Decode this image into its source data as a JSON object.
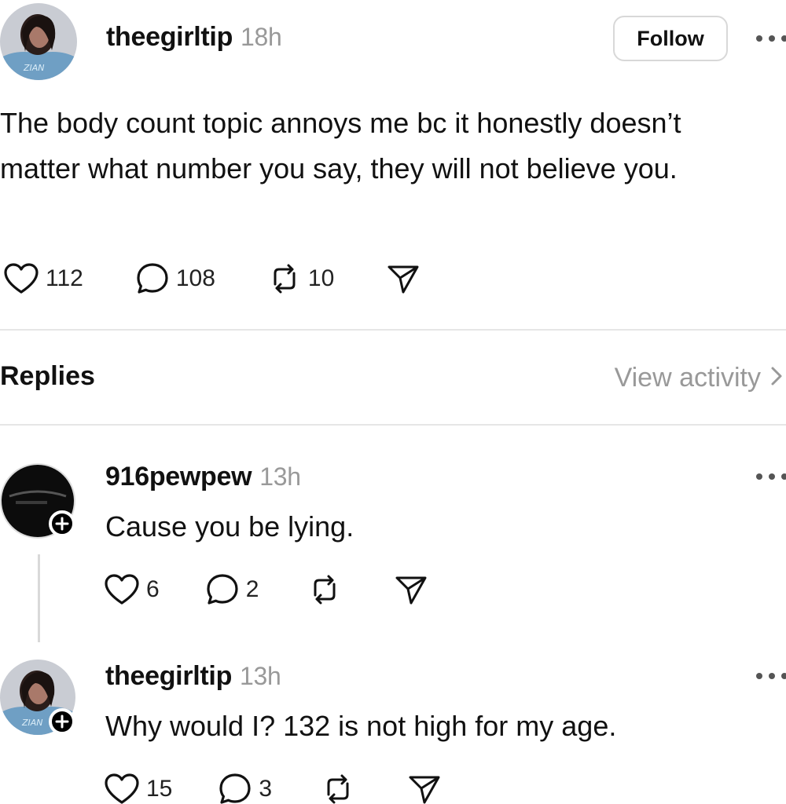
{
  "post": {
    "username": "theegirltip",
    "time": "18h",
    "follow_label": "Follow",
    "text": "The body count topic annoys me bc it honestly doesn’t matter what number you say, they will not believe you.",
    "likes": "112",
    "comments": "108",
    "reposts": "10"
  },
  "replies_section": {
    "title": "Replies",
    "view_activity": "View activity"
  },
  "replies": [
    {
      "username": "916pewpew",
      "time": "13h",
      "text": "Cause you be lying.",
      "likes": "6",
      "comments": "2"
    },
    {
      "username": "theegirltip",
      "time": "13h",
      "text": "Why would I? 132 is not high for my age.",
      "likes": "15",
      "comments": "3"
    }
  ],
  "icons": {
    "like": "heart-icon",
    "comment": "comment-bubble-icon",
    "repost": "repost-icon",
    "share": "send-icon",
    "more": "more-dots-icon",
    "follow_badge": "plus-icon"
  }
}
